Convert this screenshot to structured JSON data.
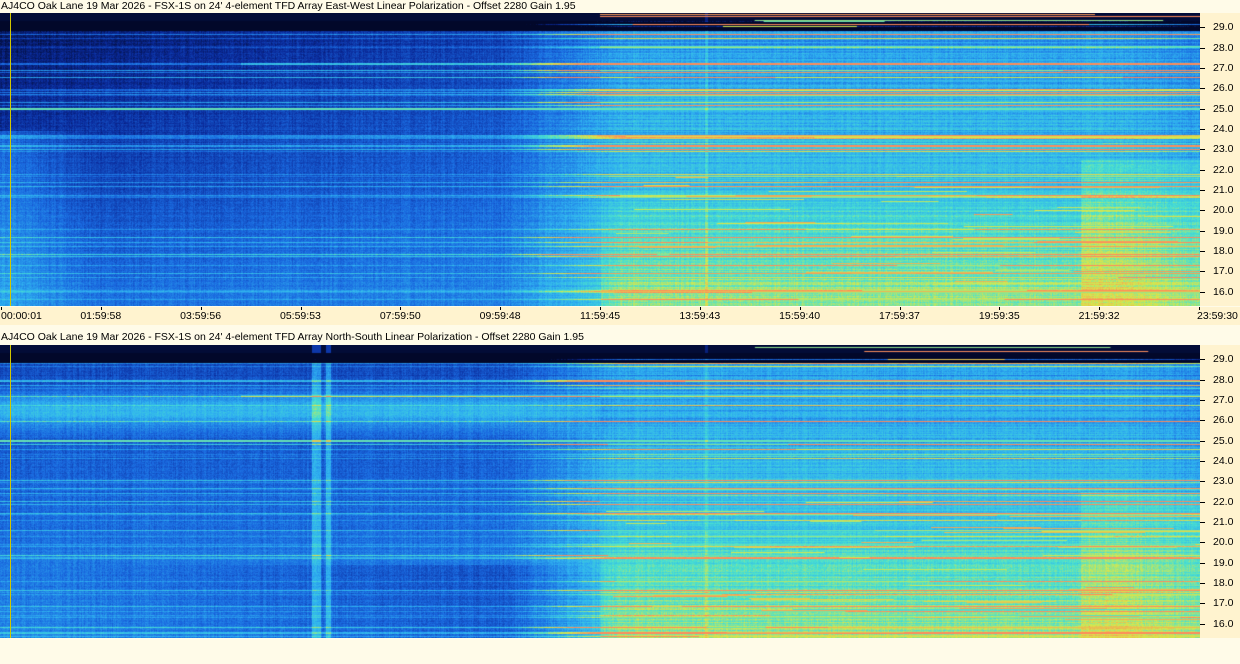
{
  "chart_data": [
    {
      "type": "heatmap",
      "title": "AJ4CO Oak Lane 19 Mar 2026 - FSX-1S on 24' 4-element TFD Array East-West Linear Polarization  -  Offset 2280  Gain 1.95",
      "xlabel": "",
      "ylabel": "",
      "x_ticks": [
        "00:00:01",
        "01:59:58",
        "03:59:56",
        "05:59:53",
        "07:59:50",
        "09:59:48",
        "11:59:45",
        "13:59:43",
        "15:59:40",
        "17:59:37",
        "19:59:35",
        "21:59:32",
        "23:59:30"
      ],
      "y_ticks": [
        "29.0",
        "28.0",
        "27.0",
        "26.0",
        "25.0",
        "24.0",
        "23.0",
        "22.0",
        "21.0",
        "20.0",
        "19.0",
        "18.0",
        "17.0",
        "16.0"
      ],
      "ylim": [
        15.3,
        29.7
      ],
      "colormap": [
        "#02082a",
        "#0a2a9a",
        "#1a6ae0",
        "#2fb0f0",
        "#49e0d0",
        "#d8e84a",
        "#ff8a5a"
      ]
    },
    {
      "type": "heatmap",
      "title": "AJ4CO Oak Lane 19 Mar 2026 - FSX-1S on 24' 4-element TFD Array North-South Linear Polarization  -  Offset 2280  Gain 1.95",
      "xlabel": "",
      "ylabel": "",
      "y_ticks": [
        "29.0",
        "28.0",
        "27.0",
        "26.0",
        "25.0",
        "24.0",
        "23.0",
        "22.0",
        "21.0",
        "20.0",
        "19.0",
        "18.0",
        "17.0",
        "16.0"
      ],
      "ylim": [
        15.3,
        29.7
      ],
      "colormap": [
        "#02082a",
        "#0a2a9a",
        "#1a6ae0",
        "#2fb0f0",
        "#49e0d0",
        "#d8e84a",
        "#ff8a5a"
      ]
    }
  ]
}
